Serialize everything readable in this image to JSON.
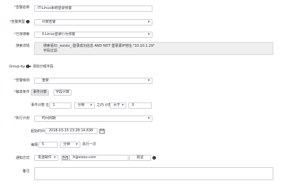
{
  "form": {
    "name": {
      "label": "告警名称",
      "value": "IT-Linux系统登录预警"
    },
    "type": {
      "label": "告警类型",
      "value": "计数告警"
    },
    "saved_search": {
      "label": "已存搜索",
      "value": "0-Linux登录行为预警"
    },
    "search_detail": {
      "label": "搜索详情",
      "line1": "搜索语句:_exists_:登录成功信息 AND NOT 登录源IP地址:\"10.10.1.29\"",
      "line2": "字段过滤:"
    },
    "group_by": {
      "label": "Group-by",
      "add_label": "添加分组字段"
    },
    "level": {
      "label": "告警级别",
      "value": "重要"
    },
    "trigger": {
      "label": "触发条件",
      "tabs": [
        "事件计数",
        "字段计数"
      ],
      "prefix": "事件计数 在",
      "period_value": "1",
      "period_unit": "分钟",
      "middle": "之内 计数",
      "operator": "大于",
      "threshold": "0"
    },
    "schedule": {
      "label": "执行计划",
      "value": "时间周期",
      "start_label": "起始时间",
      "start_value": "2018-03-15 23:28:14.638",
      "every_label": "每隔",
      "every_value": "5",
      "every_unit": "分钟",
      "every_suffix": "执行一次"
    },
    "notify": {
      "label": "通知方式",
      "method": "发送邮件",
      "email": "lt@eisoo.com",
      "verify_label": "验证"
    },
    "remark": {
      "label": "备注",
      "value": ""
    }
  },
  "icons": {
    "caret": "caret-down-icon",
    "plus": "plus-icon",
    "calendar": "calendar-icon",
    "mail": "envelope-icon",
    "info": "info-icon"
  }
}
